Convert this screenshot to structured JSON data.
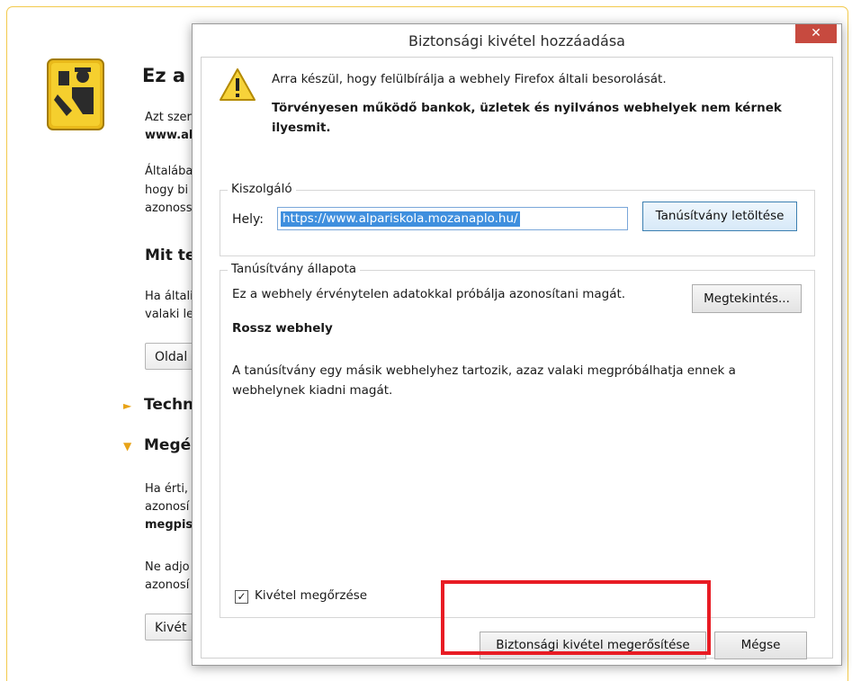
{
  "background_page": {
    "title": "Ez a",
    "para1_line1": "Azt szer",
    "para1_line2": "www.al",
    "para2_line1": "Általába",
    "para2_line2": "hogy bi",
    "para2_line3": "azonoss",
    "heading_what": "Mit te",
    "para3_line1": "Ha általi",
    "para3_line2": "valaki le",
    "button_back": "Oldal",
    "section_technical": "Techn",
    "section_understand": "Megé",
    "para4_line1": "Ha érti,",
    "para4_line2": "azonosí",
    "para4_line3": "megpis",
    "para5_line1": "Ne adjo",
    "para5_line2": "azonosí",
    "button_exception": "Kivét",
    "arrow_collapsed": "►",
    "arrow_expanded": "▼"
  },
  "dialog": {
    "title": "Biztonsági kivétel hozzáadása",
    "close_glyph": "✕",
    "message": "Arra készül, hogy felülbírálja a webhely Firefox általi besorolását.",
    "warning": "Törvényesen működő bankok, üzletek és nyilvános webhelyek nem kérnek ilyesmit.",
    "server_group": "Kiszolgáló",
    "location_label": "Hely:",
    "location_value": "https://www.alpariskola.mozanaplo.hu/",
    "get_cert_button": "Tanúsítvány letöltése",
    "status_group": "Tanúsítvány állapota",
    "status_text": "Ez a webhely érvénytelen adatokkal próbálja azonosítani magát.",
    "view_button": "Megtekintés...",
    "bad_site_title": "Rossz webhely",
    "bad_site_desc": "A tanúsítvány egy másik webhelyhez tartozik, azaz valaki megpróbálhatja ennek a webhelynek kiadni magát.",
    "permanent_checkbox": "Kivétel megőrzése",
    "permanent_checked": true,
    "check_glyph": "✓",
    "confirm_button": "Biztonsági kivétel megerősítése",
    "cancel_button": "Mégse"
  },
  "colors": {
    "highlight": "#e81c24",
    "close_button": "#c74a3f",
    "url_selection": "#3f8fde",
    "page_border": "#f2c94c"
  }
}
